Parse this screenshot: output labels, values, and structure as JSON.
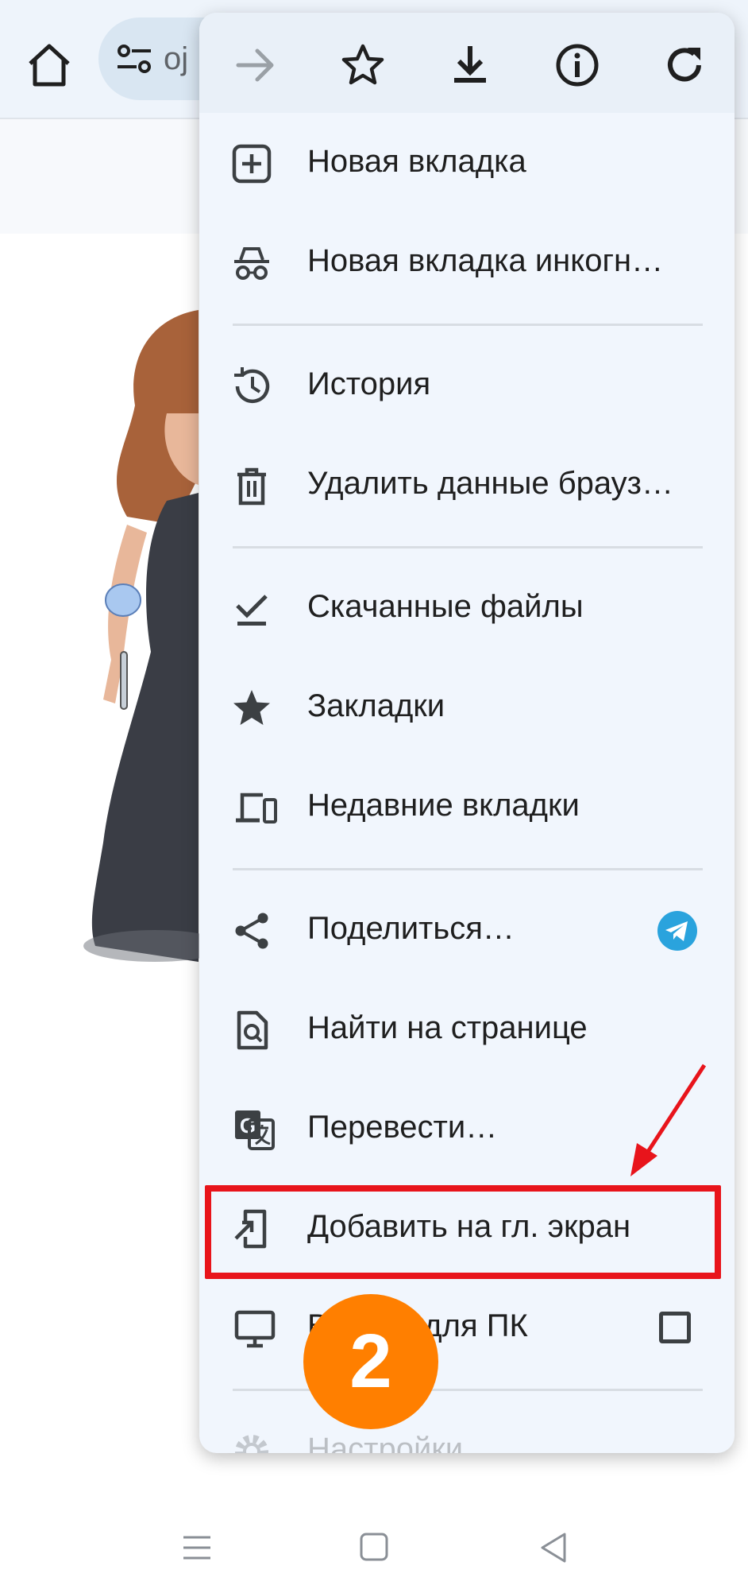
{
  "browser": {
    "url_fragment": "oj"
  },
  "menu": {
    "items": [
      {
        "label": "Новая вкладка",
        "icon": "new-tab-icon"
      },
      {
        "label": "Новая вкладка инкогн…",
        "icon": "incognito-icon"
      },
      {
        "label": "История",
        "icon": "history-icon"
      },
      {
        "label": "Удалить данные брауз…",
        "icon": "trash-icon"
      },
      {
        "label": "Скачанные файлы",
        "icon": "downloads-check-icon"
      },
      {
        "label": "Закладки",
        "icon": "star-filled-icon"
      },
      {
        "label": "Недавние вкладки",
        "icon": "devices-icon"
      },
      {
        "label": "Поделиться…",
        "icon": "share-icon"
      },
      {
        "label": "Найти на странице",
        "icon": "find-in-page-icon"
      },
      {
        "label": "Перевести…",
        "icon": "translate-icon"
      },
      {
        "label": "Добавить на гл. экран",
        "icon": "add-to-home-icon"
      },
      {
        "label": "Версия для ПК",
        "icon": "desktop-icon"
      },
      {
        "label": "Настройки",
        "icon": "settings-icon"
      }
    ]
  },
  "annotation": {
    "step_number": "2",
    "highlight_color": "#e8141b",
    "badge_color": "#ff7f00"
  },
  "colors": {
    "menu_bg": "#f1f6fd",
    "toolbar_bg": "#e9f0f8",
    "telegram_blue": "#2aa3dd"
  }
}
